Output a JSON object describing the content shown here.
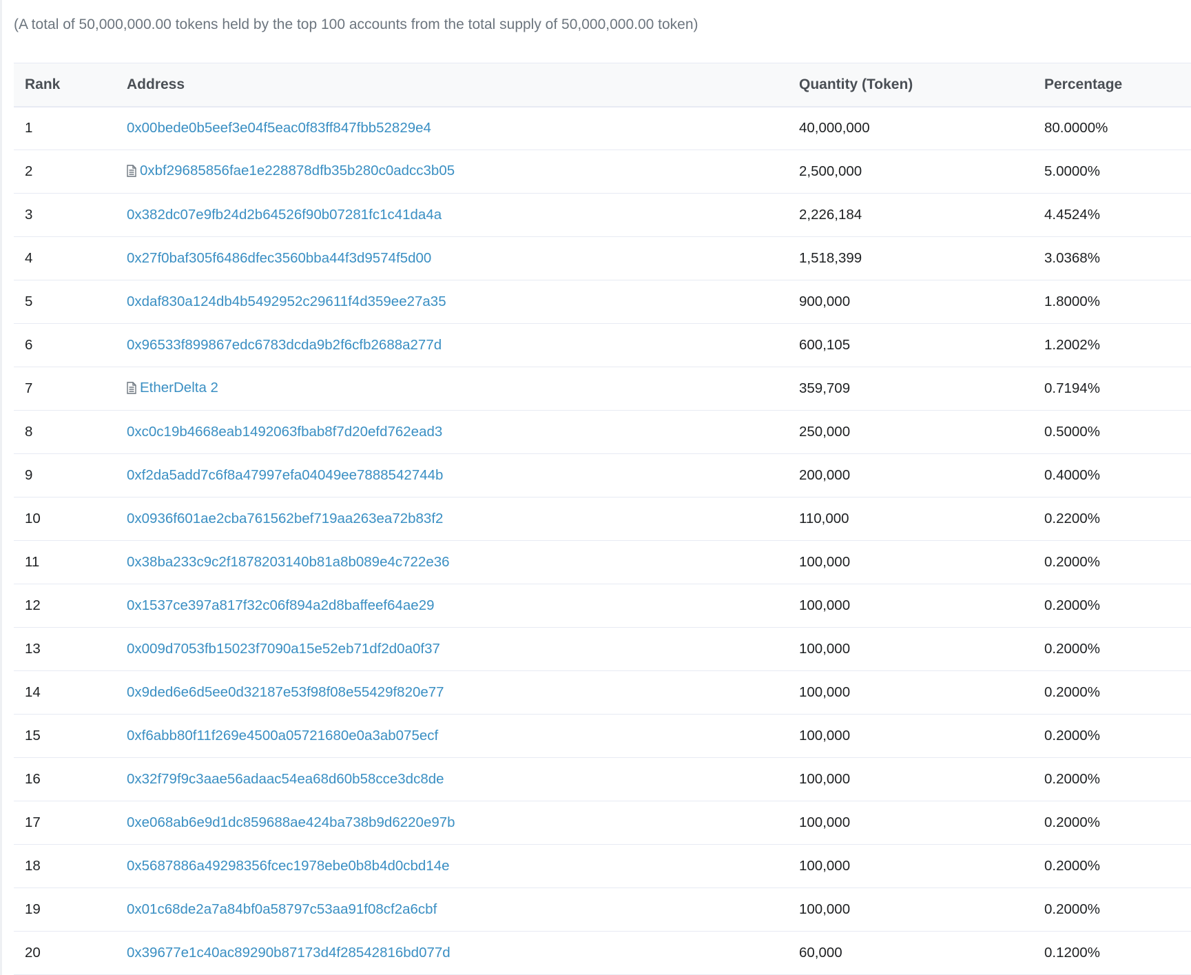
{
  "summary": "(A total of 50,000,000.00 tokens held by the top 100 accounts from the total supply of 50,000,000.00 token)",
  "table": {
    "headers": {
      "rank": "Rank",
      "address": "Address",
      "quantity": "Quantity (Token)",
      "percentage": "Percentage"
    },
    "rows": [
      {
        "rank": "1",
        "address": "0x00bede0b5eef3e04f5eac0f83ff847fbb52829e4",
        "contract": false,
        "quantity": "40,000,000",
        "percentage": "80.0000%"
      },
      {
        "rank": "2",
        "address": "0xbf29685856fae1e228878dfb35b280c0adcc3b05",
        "contract": true,
        "quantity": "2,500,000",
        "percentage": "5.0000%"
      },
      {
        "rank": "3",
        "address": "0x382dc07e9fb24d2b64526f90b07281fc1c41da4a",
        "contract": false,
        "quantity": "2,226,184",
        "percentage": "4.4524%"
      },
      {
        "rank": "4",
        "address": "0x27f0baf305f6486dfec3560bba44f3d9574f5d00",
        "contract": false,
        "quantity": "1,518,399",
        "percentage": "3.0368%"
      },
      {
        "rank": "5",
        "address": "0xdaf830a124db4b5492952c29611f4d359ee27a35",
        "contract": false,
        "quantity": "900,000",
        "percentage": "1.8000%"
      },
      {
        "rank": "6",
        "address": "0x96533f899867edc6783dcda9b2f6cfb2688a277d",
        "contract": false,
        "quantity": "600,105",
        "percentage": "1.2002%"
      },
      {
        "rank": "7",
        "address": "EtherDelta 2",
        "contract": true,
        "quantity": "359,709",
        "percentage": "0.7194%"
      },
      {
        "rank": "8",
        "address": "0xc0c19b4668eab1492063fbab8f7d20efd762ead3",
        "contract": false,
        "quantity": "250,000",
        "percentage": "0.5000%"
      },
      {
        "rank": "9",
        "address": "0xf2da5add7c6f8a47997efa04049ee7888542744b",
        "contract": false,
        "quantity": "200,000",
        "percentage": "0.4000%"
      },
      {
        "rank": "10",
        "address": "0x0936f601ae2cba761562bef719aa263ea72b83f2",
        "contract": false,
        "quantity": "110,000",
        "percentage": "0.2200%"
      },
      {
        "rank": "11",
        "address": "0x38ba233c9c2f1878203140b81a8b089e4c722e36",
        "contract": false,
        "quantity": "100,000",
        "percentage": "0.2000%"
      },
      {
        "rank": "12",
        "address": "0x1537ce397a817f32c06f894a2d8baffeef64ae29",
        "contract": false,
        "quantity": "100,000",
        "percentage": "0.2000%"
      },
      {
        "rank": "13",
        "address": "0x009d7053fb15023f7090a15e52eb71df2d0a0f37",
        "contract": false,
        "quantity": "100,000",
        "percentage": "0.2000%"
      },
      {
        "rank": "14",
        "address": "0x9ded6e6d5ee0d32187e53f98f08e55429f820e77",
        "contract": false,
        "quantity": "100,000",
        "percentage": "0.2000%"
      },
      {
        "rank": "15",
        "address": "0xf6abb80f11f269e4500a05721680e0a3ab075ecf",
        "contract": false,
        "quantity": "100,000",
        "percentage": "0.2000%"
      },
      {
        "rank": "16",
        "address": "0x32f79f9c3aae56adaac54ea68d60b58cce3dc8de",
        "contract": false,
        "quantity": "100,000",
        "percentage": "0.2000%"
      },
      {
        "rank": "17",
        "address": "0xe068ab6e9d1dc859688ae424ba738b9d6220e97b",
        "contract": false,
        "quantity": "100,000",
        "percentage": "0.2000%"
      },
      {
        "rank": "18",
        "address": "0x5687886a49298356fcec1978ebe0b8b4d0cbd14e",
        "contract": false,
        "quantity": "100,000",
        "percentage": "0.2000%"
      },
      {
        "rank": "19",
        "address": "0x01c68de2a7a84bf0a58797c53aa91f08cf2a6cbf",
        "contract": false,
        "quantity": "100,000",
        "percentage": "0.2000%"
      },
      {
        "rank": "20",
        "address": "0x39677e1c40ac89290b87173d4f28542816bd077d",
        "contract": false,
        "quantity": "60,000",
        "percentage": "0.1200%"
      }
    ]
  },
  "colors": {
    "link": "#3a8fc3",
    "muted_text": "#6c757e",
    "header_bg": "#f8f9fa",
    "border": "#e7eaf3"
  },
  "icons": {
    "contract": "file-text-icon"
  }
}
